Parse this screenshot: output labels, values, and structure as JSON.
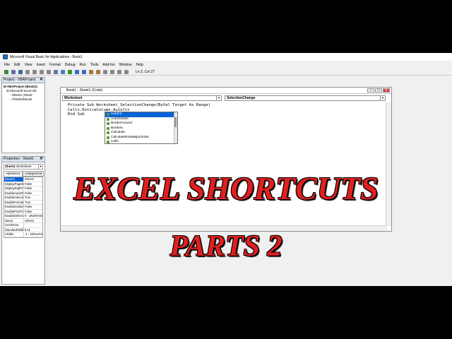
{
  "window": {
    "title": "Microsoft Visual Basic for Applications - Book1"
  },
  "menu": [
    "File",
    "Edit",
    "View",
    "Insert",
    "Format",
    "Debug",
    "Run",
    "Tools",
    "Add-Ins",
    "Window",
    "Help"
  ],
  "toolbar": {
    "position": "Ln 2, Col 27"
  },
  "project_pane": {
    "title": "Project - VBAProject",
    "tree": [
      "VBAProject (Book1)",
      "Microsoft Excel Ob",
      "Sheet1 (Sheet",
      "ThisWorkbook"
    ]
  },
  "properties_pane": {
    "title": "Properties - Sheet1",
    "object": "Sheet1",
    "object_type": "Worksheet",
    "tabs": [
      "Alphabetic",
      "Categorized"
    ],
    "rows": [
      {
        "k": "(Name)",
        "v": "Sheet1"
      },
      {
        "k": "DisplayPageBre",
        "v": "False"
      },
      {
        "k": "DisplayRightToL",
        "v": "False"
      },
      {
        "k": "EnableAutoFilte",
        "v": "False"
      },
      {
        "k": "EnableCalculatio",
        "v": "True"
      },
      {
        "k": "EnableFormatCo",
        "v": "True"
      },
      {
        "k": "EnableOutlining",
        "v": "False"
      },
      {
        "k": "EnablePivotTab",
        "v": "False"
      },
      {
        "k": "EnableSelection",
        "v": "0 - xlNoRestri"
      },
      {
        "k": "Name",
        "v": "Sheet1"
      },
      {
        "k": "ScrollArea",
        "v": ""
      },
      {
        "k": "StandardWidth",
        "v": "8.11"
      },
      {
        "k": "Visible",
        "v": "-1 - xlSheetVi"
      }
    ]
  },
  "code_window": {
    "title": "Book1 - Sheet1 (Code)",
    "object_combo": "Worksheet",
    "proc_combo": "SelectionChange",
    "lines": [
      "Private Sub Worksheet_SelectionChange(ByVal Target As Range)",
      "Cells.EntireColumn.Autofit",
      "End Sub"
    ]
  },
  "autocomplete": {
    "items": [
      "AutoFit",
      "AutoOutline",
      "BorderAround",
      "Borders",
      "Calculate",
      "CalculateRowMajorOrder",
      "Cells"
    ],
    "selected": "AutoFit"
  },
  "overlay": {
    "line1": "EXCEL SHORTCUTS",
    "line2": "PARTS 2"
  }
}
